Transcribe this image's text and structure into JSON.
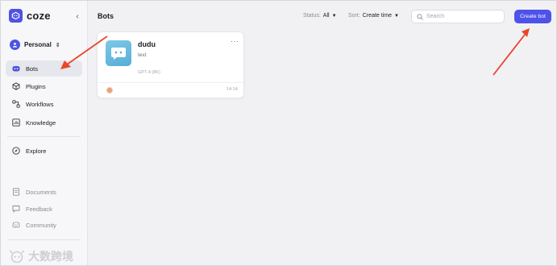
{
  "app": {
    "logo_text": "coze"
  },
  "sidebar": {
    "workspace": "Personal",
    "nav": [
      {
        "label": "Bots",
        "icon": "bot-icon",
        "active": true
      },
      {
        "label": "Plugins",
        "icon": "cube-icon"
      },
      {
        "label": "Workflows",
        "icon": "workflow-icon"
      },
      {
        "label": "Knowledge",
        "icon": "knowledge-icon"
      }
    ],
    "explore": {
      "label": "Explore",
      "icon": "compass-icon"
    },
    "footer": [
      {
        "label": "Documents",
        "icon": "document-icon"
      },
      {
        "label": "Feedback",
        "icon": "feedback-icon"
      },
      {
        "label": "Community",
        "icon": "discord-icon"
      }
    ]
  },
  "header": {
    "title": "Bots",
    "status_label": "Status:",
    "status_value": "All",
    "sort_label": "Sort:",
    "sort_value": "Create time",
    "search_placeholder": "Search",
    "create_label": "Create bot"
  },
  "bots": [
    {
      "name": "dudu",
      "description": "text",
      "model": "GPT-4 (8K)",
      "time": "14:14"
    }
  ],
  "watermark": "大数跨境",
  "colors": {
    "accent": "#4d53e8",
    "arrow": "#e8462b"
  }
}
